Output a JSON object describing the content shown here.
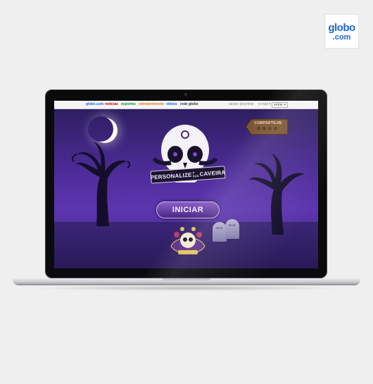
{
  "brand": {
    "line1": "globo",
    "line2": ".com",
    "color": "#1e66cf"
  },
  "site_nav": {
    "items": [
      "globo.com",
      "notícias",
      "esportes",
      "entretenimento",
      "vídeos",
      "rede globo"
    ],
    "utility": [
      "assine já",
      "central",
      "e-mail ▾",
      "entrar ▾"
    ]
  },
  "game": {
    "title_left": "PERSONALIZE",
    "title_mid": "A SUA",
    "title_right": "CAVEIRA",
    "start_button": "INICIAR",
    "sign_label": "COMPARTILHE",
    "tombstone_text": "R.I.P.",
    "colors": {
      "accent": "#5d36b0",
      "button": "#6a3fa8"
    }
  }
}
